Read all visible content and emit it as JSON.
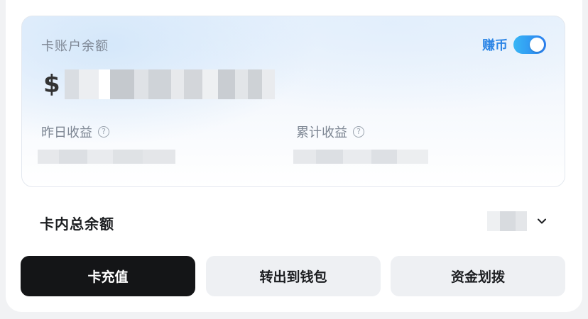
{
  "card": {
    "title": "卡账户余额",
    "earn_label": "赚币",
    "earn_toggle_on": true,
    "currency_symbol": "$",
    "yesterday_label": "昨日收益",
    "cumulative_label": "累计收益"
  },
  "total": {
    "label": "卡内总余额"
  },
  "actions": {
    "recharge": "卡充值",
    "transfer_out": "转出到钱包",
    "allocate": "资金划拨"
  },
  "icons": {
    "help": "question-circle-icon",
    "dropdown": "chevron-down-icon"
  },
  "colors": {
    "accent_blue": "#2d86e6",
    "toggle_on": "#38b6f5",
    "primary_button": "#141517"
  }
}
